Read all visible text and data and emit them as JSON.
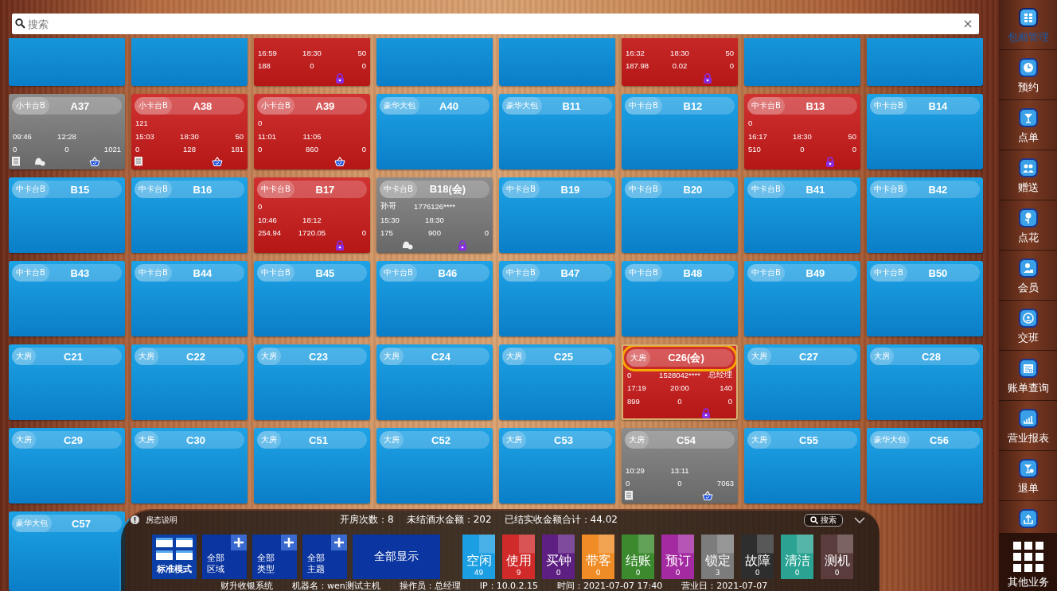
{
  "search": {
    "placeholder": "搜索"
  },
  "rows": [
    {
      "tiles": [
        {
          "kind": "free",
          "selected": false
        },
        {
          "kind": "free",
          "selected": false
        },
        {
          "kind": "in_use",
          "selected": false,
          "lines": [
            [
              "16:59",
              "18:30",
              "50"
            ],
            [
              "188",
              "0",
              "0"
            ]
          ],
          "bill": false,
          "call": false,
          "order": false,
          "lock": true
        },
        {
          "kind": "free",
          "selected": false
        },
        {
          "kind": "free",
          "selected": false
        },
        {
          "kind": "in_use",
          "selected": false,
          "lines": [
            [
              "16:32",
              "18:30",
              "50"
            ],
            [
              "187.98",
              "0.02",
              "0"
            ]
          ],
          "bill": false,
          "call": false,
          "order": false,
          "lock": true
        },
        {
          "kind": "free",
          "selected": false
        },
        {
          "kind": "free",
          "selected": false
        }
      ]
    },
    {
      "tiles": [
        {
          "name": "A37",
          "type": "小卡台B",
          "kind": "locked",
          "selected": false,
          "lines": [
            [
              "09:46",
              "12:28"
            ],
            [
              "0",
              "0",
              "1021"
            ]
          ],
          "bill": true,
          "call": true,
          "order": true,
          "lock": false
        },
        {
          "name": "A38",
          "type": "小卡台B",
          "kind": "in_use",
          "selected": false,
          "lines": [
            [
              "121"
            ],
            [
              "15:03",
              "18:30",
              "50"
            ],
            [
              "0",
              "128",
              "181"
            ]
          ],
          "bill": true,
          "call": false,
          "order": true,
          "lock": false
        },
        {
          "name": "A39",
          "type": "小卡台B",
          "kind": "in_use",
          "selected": false,
          "lines": [
            [
              "0"
            ],
            [
              "11:01",
              "11:05"
            ],
            [
              "0",
              "860",
              "0"
            ]
          ],
          "bill": false,
          "call": false,
          "order": true,
          "lock": false
        },
        {
          "name": "A40",
          "type": "豪华大包",
          "kind": "free",
          "selected": false
        },
        {
          "name": "B11",
          "type": "豪华大包",
          "kind": "free",
          "selected": false
        },
        {
          "name": "B12",
          "type": "中卡台B",
          "kind": "free",
          "selected": false
        },
        {
          "name": "B13",
          "type": "中卡台B",
          "kind": "in_use",
          "selected": false,
          "lines": [
            [
              "0"
            ],
            [
              "16:17",
              "18:30",
              "50"
            ],
            [
              "510",
              "0",
              "0"
            ]
          ],
          "bill": false,
          "call": false,
          "order": false,
          "lock": true
        },
        {
          "name": "B14",
          "type": "中卡台B",
          "kind": "free",
          "selected": false
        }
      ]
    },
    {
      "tiles": [
        {
          "name": "B15",
          "type": "中卡台B",
          "kind": "free",
          "selected": false
        },
        {
          "name": "B16",
          "type": "中卡台B",
          "kind": "free",
          "selected": false
        },
        {
          "name": "B17",
          "type": "中卡台B",
          "kind": "in_use",
          "selected": false,
          "lines": [
            [
              "0"
            ],
            [
              "10:46",
              "18:12"
            ],
            [
              "254.94",
              "1720.05",
              "0"
            ]
          ],
          "bill": false,
          "call": false,
          "order": false,
          "lock": true
        },
        {
          "name": "B18(会)",
          "type": "中卡台B",
          "kind": "locked",
          "selected": false,
          "lines": [
            [
              "孙哥",
              "1776126****"
            ],
            [
              "15:30",
              "18:30"
            ],
            [
              "175",
              "900",
              "0"
            ]
          ],
          "bill": false,
          "call": true,
          "order": false,
          "lock": true
        },
        {
          "name": "B19",
          "type": "中卡台B",
          "kind": "free",
          "selected": false
        },
        {
          "name": "B20",
          "type": "中卡台B",
          "kind": "free",
          "selected": false
        },
        {
          "name": "B41",
          "type": "中卡台B",
          "kind": "free",
          "selected": false
        },
        {
          "name": "B42",
          "type": "中卡台B",
          "kind": "free",
          "selected": false
        }
      ]
    },
    {
      "tiles": [
        {
          "name": "B43",
          "type": "中卡台B",
          "kind": "free",
          "selected": false
        },
        {
          "name": "B44",
          "type": "中卡台B",
          "kind": "free",
          "selected": false
        },
        {
          "name": "B45",
          "type": "中卡台B",
          "kind": "free",
          "selected": false
        },
        {
          "name": "B46",
          "type": "中卡台B",
          "kind": "free",
          "selected": false
        },
        {
          "name": "B47",
          "type": "中卡台B",
          "kind": "free",
          "selected": false
        },
        {
          "name": "B48",
          "type": "中卡台B",
          "kind": "free",
          "selected": false
        },
        {
          "name": "B49",
          "type": "中卡台B",
          "kind": "free",
          "selected": false
        },
        {
          "name": "B50",
          "type": "中卡台B",
          "kind": "free",
          "selected": false
        }
      ]
    },
    {
      "tiles": [
        {
          "name": "C21",
          "type": "大房",
          "kind": "free",
          "selected": false
        },
        {
          "name": "C22",
          "type": "大房",
          "kind": "free",
          "selected": false
        },
        {
          "name": "C23",
          "type": "大房",
          "kind": "free",
          "selected": false
        },
        {
          "name": "C24",
          "type": "大房",
          "kind": "free",
          "selected": false
        },
        {
          "name": "C25",
          "type": "大房",
          "kind": "free",
          "selected": false
        },
        {
          "name": "C26(会)",
          "type": "大房",
          "kind": "in_use",
          "selected": true,
          "lines": [
            [
              "0",
              "1528042****",
              "总经理"
            ],
            [
              "17:19",
              "20:00",
              "140"
            ],
            [
              "899",
              "0",
              "0"
            ]
          ],
          "bill": false,
          "call": false,
          "order": false,
          "lock": true
        },
        {
          "name": "C27",
          "type": "大房",
          "kind": "free",
          "selected": false
        },
        {
          "name": "C28",
          "type": "大房",
          "kind": "free",
          "selected": false
        }
      ]
    },
    {
      "tiles": [
        {
          "name": "C29",
          "type": "大房",
          "kind": "free",
          "selected": false
        },
        {
          "name": "C30",
          "type": "大房",
          "kind": "free",
          "selected": false
        },
        {
          "name": "C51",
          "type": "大房",
          "kind": "free",
          "selected": false
        },
        {
          "name": "C52",
          "type": "大房",
          "kind": "free",
          "selected": false
        },
        {
          "name": "C53",
          "type": "大房",
          "kind": "free",
          "selected": false
        },
        {
          "name": "C54",
          "type": "大房",
          "kind": "locked",
          "selected": false,
          "lines": [
            [
              "10:29",
              "13:11"
            ],
            [
              "0",
              "0",
              "7063"
            ]
          ],
          "bill": true,
          "call": false,
          "order": true,
          "lock": false
        },
        {
          "name": "C55",
          "type": "大房",
          "kind": "free",
          "selected": false
        },
        {
          "name": "C56",
          "type": "豪华大包",
          "kind": "free",
          "selected": false
        }
      ]
    },
    {
      "tiles": [
        {
          "name": "C57",
          "type": "豪华大包",
          "kind": "free",
          "selected": false
        }
      ]
    }
  ],
  "legend_panel": {
    "title": "房态说明",
    "stats": [
      "开房次数：8",
      "未结酒水金额：202",
      "已结实收金额合计：44.02"
    ],
    "search_button": "搜索",
    "mode_button": "标准模式",
    "filters": [
      [
        "全部",
        "区域"
      ],
      [
        "全部",
        "类型"
      ],
      [
        "全部",
        "主题"
      ]
    ],
    "show_all": "全部显示",
    "statuses": [
      {
        "label": "空闲",
        "count": "49",
        "color": "#1b9ee2"
      },
      {
        "label": "使用",
        "count": "9",
        "color": "#d02a2a"
      },
      {
        "label": "买钟",
        "count": "0",
        "color": "#5e1f82"
      },
      {
        "label": "带客",
        "count": "0",
        "color": "#ef8c25"
      },
      {
        "label": "结账",
        "count": "0",
        "color": "#3b8a2e"
      },
      {
        "label": "预订",
        "count": "0",
        "color": "#a42aa2"
      },
      {
        "label": "锁定",
        "count": "3",
        "color": "#7c7c7c"
      },
      {
        "label": "故障",
        "count": "0",
        "color": "#2e2e2e"
      },
      {
        "label": "清洁",
        "count": "0",
        "color": "#2aa393"
      },
      {
        "label": "测机",
        "count": "0",
        "color": "#5a3c3c"
      }
    ],
    "footer": [
      "财升收银系统",
      "机器名：wen测试主机",
      "操作员：总经理",
      "IP：10.0.2.15",
      "时间：2021-07-07 17:40",
      "营业日：2021-07-07"
    ]
  },
  "sidebar": {
    "items": [
      {
        "label": "包厢管理",
        "selected": true
      },
      {
        "label": "预约",
        "selected": false
      },
      {
        "label": "点单",
        "selected": false
      },
      {
        "label": "赠送",
        "selected": false
      },
      {
        "label": "点花",
        "selected": false
      },
      {
        "label": "会员",
        "selected": false
      },
      {
        "label": "交班",
        "selected": false
      },
      {
        "label": "账单查询",
        "selected": false
      },
      {
        "label": "营业报表",
        "selected": false
      },
      {
        "label": "退单",
        "selected": false
      },
      {
        "selected": false
      }
    ],
    "more": {
      "label": "其他业务"
    }
  }
}
